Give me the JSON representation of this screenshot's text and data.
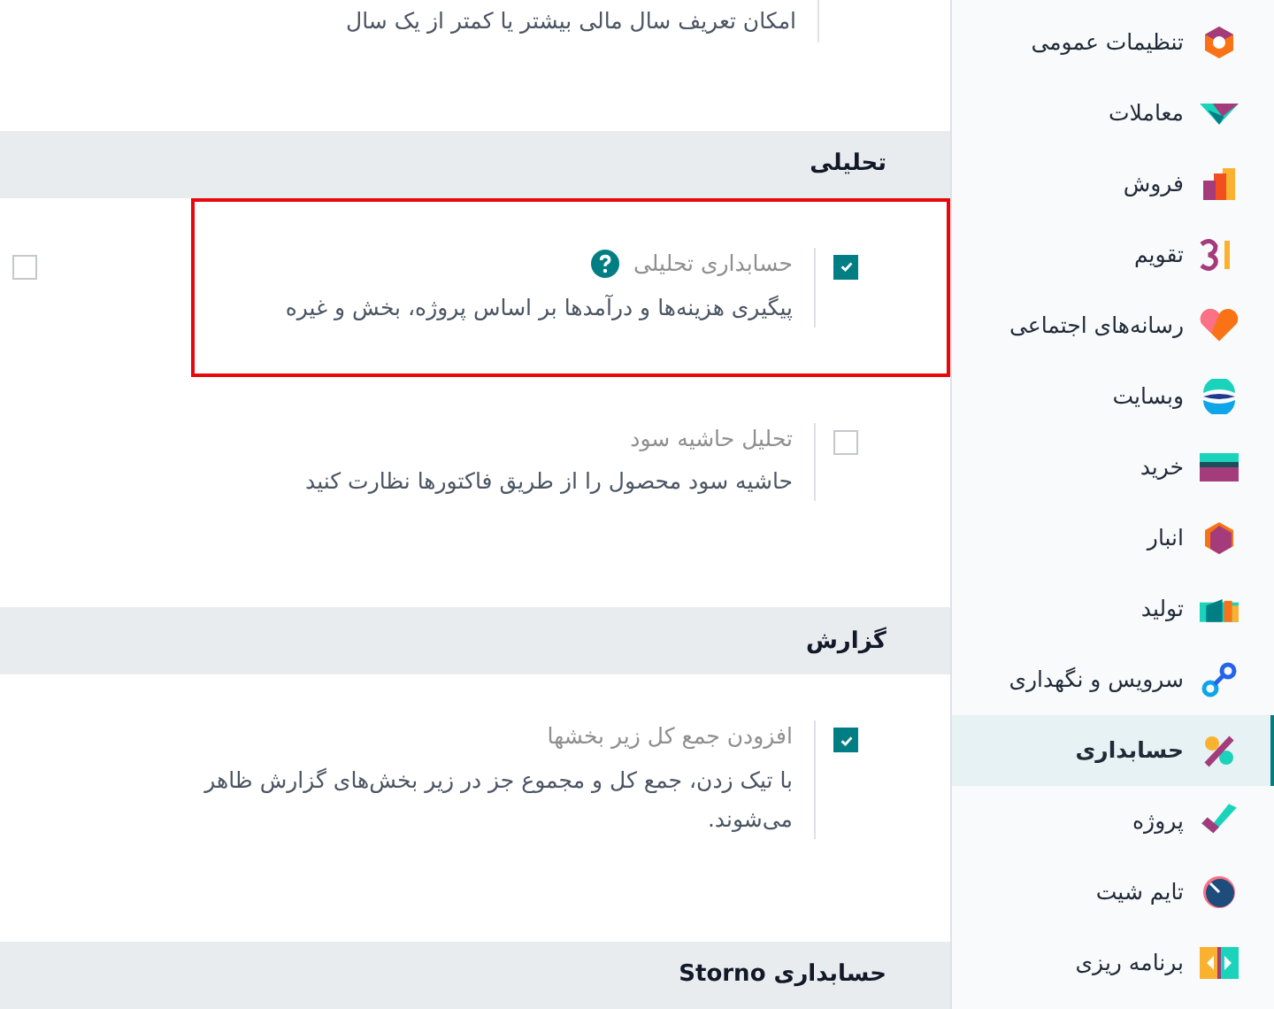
{
  "intro_text": "امکان تعریف سال مالی بیشتر یا کمتر از یک سال",
  "sections": [
    {
      "title": "تحلیلی",
      "settings": [
        {
          "title": "حسابداری تحلیلی",
          "help": true,
          "description": "پیگیری هزینه‌ها و درآمدها بر اساس پروژه، بخش و غیره",
          "checked": true,
          "highlighted": true,
          "column_2": {
            "checked": false
          }
        },
        {
          "title": "تحلیل حاشیه سود",
          "help": false,
          "description": "حاشیه سود محصول را از طریق فاکتورها نظارت کنید",
          "checked": false,
          "highlighted": false
        }
      ]
    },
    {
      "title": "گزارش",
      "settings": [
        {
          "title": "افزودن جمع کل زیر بخشها",
          "help": false,
          "description": "با تیک زدن، جمع کل و مجموع جز در زیر بخش‌های گزارش ظاهر می‌شوند.",
          "checked": true,
          "highlighted": false
        }
      ]
    },
    {
      "title": "حسابداری Storno"
    }
  ],
  "sidebar": {
    "items": [
      {
        "label": "تنظیمات عمومی",
        "selected": false
      },
      {
        "label": "معاملات",
        "selected": false
      },
      {
        "label": "فروش",
        "selected": false
      },
      {
        "label": "تقویم",
        "selected": false
      },
      {
        "label": "رسانه‌های اجتماعی",
        "selected": false
      },
      {
        "label": "وبسایت",
        "selected": false
      },
      {
        "label": "خرید",
        "selected": false
      },
      {
        "label": "انبار",
        "selected": false
      },
      {
        "label": "تولید",
        "selected": false
      },
      {
        "label": "سرویس و نگهداری",
        "selected": false
      },
      {
        "label": "حسابداری",
        "selected": true
      },
      {
        "label": "پروژه",
        "selected": false
      },
      {
        "label": "تایم شیت",
        "selected": false
      },
      {
        "label": "برنامه ریزی",
        "selected": false
      }
    ]
  }
}
